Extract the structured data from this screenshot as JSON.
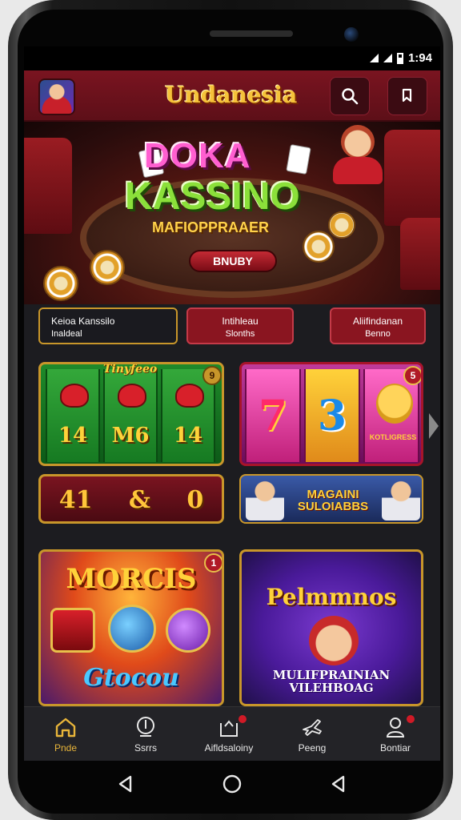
{
  "status": {
    "time": "1:94"
  },
  "header": {
    "brand": "Undanesia"
  },
  "banner": {
    "title_line1": "DOKA",
    "title_line2": "KASSINO",
    "subtitle": "MAFIOPPRAAER",
    "cta_label": "BNUBY"
  },
  "categories": [
    {
      "line1": "Keioa Kanssilo",
      "line2": "Inaldeal"
    },
    {
      "line1": "Intihleau",
      "line2": "Slonths"
    },
    {
      "line1": "Aliifindanan",
      "line2": "Benno"
    }
  ],
  "games": {
    "slot_green": {
      "tag": "Tinyfeeo",
      "badge": "9",
      "reels": [
        "14",
        "M6",
        "14"
      ]
    },
    "slot_pink": {
      "badge": "5",
      "symbols": [
        "7",
        "3"
      ],
      "mascot_label": "KOTLIGRESS"
    },
    "strip_red": {
      "numbers": [
        "41",
        "&",
        "0"
      ]
    },
    "strip_blue": {
      "title_line1": "MAGAINI",
      "title_line2": "SULOIABBS"
    },
    "big_orange": {
      "title": "MORCIS",
      "subtitle": "Gtocou",
      "badge": "1"
    },
    "big_purple": {
      "title": "Pelmmnos",
      "subtitle_line1": "MULIFPRAINIAN",
      "subtitle_line2": "VILEHBOAG"
    }
  },
  "bottom_nav": [
    {
      "label": "Pnde",
      "icon": "home-icon",
      "active": true
    },
    {
      "label": "Ssrrs",
      "icon": "globe-icon",
      "active": false
    },
    {
      "label": "Aifldsaloiny",
      "icon": "inbox-icon",
      "active": false
    },
    {
      "label": "Peeng",
      "icon": "plane-icon",
      "active": false
    },
    {
      "label": "Bontiar",
      "icon": "user-icon",
      "active": false
    }
  ],
  "colors": {
    "accent": "#e8b53a",
    "brand_red": "#7a1420",
    "background": "#1c1c20"
  }
}
